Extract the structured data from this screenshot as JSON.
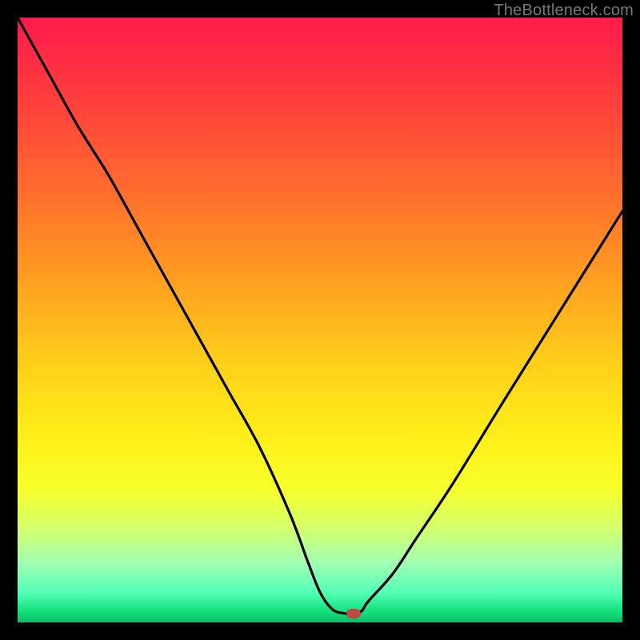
{
  "watermark": "TheBottleneck.com",
  "chart_data": {
    "type": "line",
    "title": "",
    "xlabel": "",
    "ylabel": "",
    "xlim": [
      0,
      100
    ],
    "ylim": [
      0,
      100
    ],
    "grid": false,
    "legend": false,
    "series": [
      {
        "name": "bottleneck-curve",
        "x": [
          0,
          5,
          10,
          15,
          20,
          25,
          30,
          35,
          40,
          45,
          48,
          50,
          52,
          54,
          56,
          57,
          58,
          62,
          66,
          72,
          80,
          90,
          100
        ],
        "y": [
          100,
          91,
          82,
          74,
          65,
          56,
          47,
          38,
          29,
          18,
          10,
          5,
          2.2,
          1.5,
          1.5,
          2,
          3.5,
          8,
          14,
          23,
          36,
          52,
          68
        ]
      }
    ],
    "marker": {
      "x": 55.5,
      "y": 1.5,
      "color": "#c2493f"
    },
    "background": {
      "gradient_stops": [
        {
          "pos": 0,
          "color": "#ff1a4b"
        },
        {
          "pos": 28,
          "color": "#ff6a2f"
        },
        {
          "pos": 58,
          "color": "#ffd21a"
        },
        {
          "pos": 84,
          "color": "#d8ff66"
        },
        {
          "pos": 100,
          "color": "#0dbf6a"
        }
      ]
    }
  }
}
